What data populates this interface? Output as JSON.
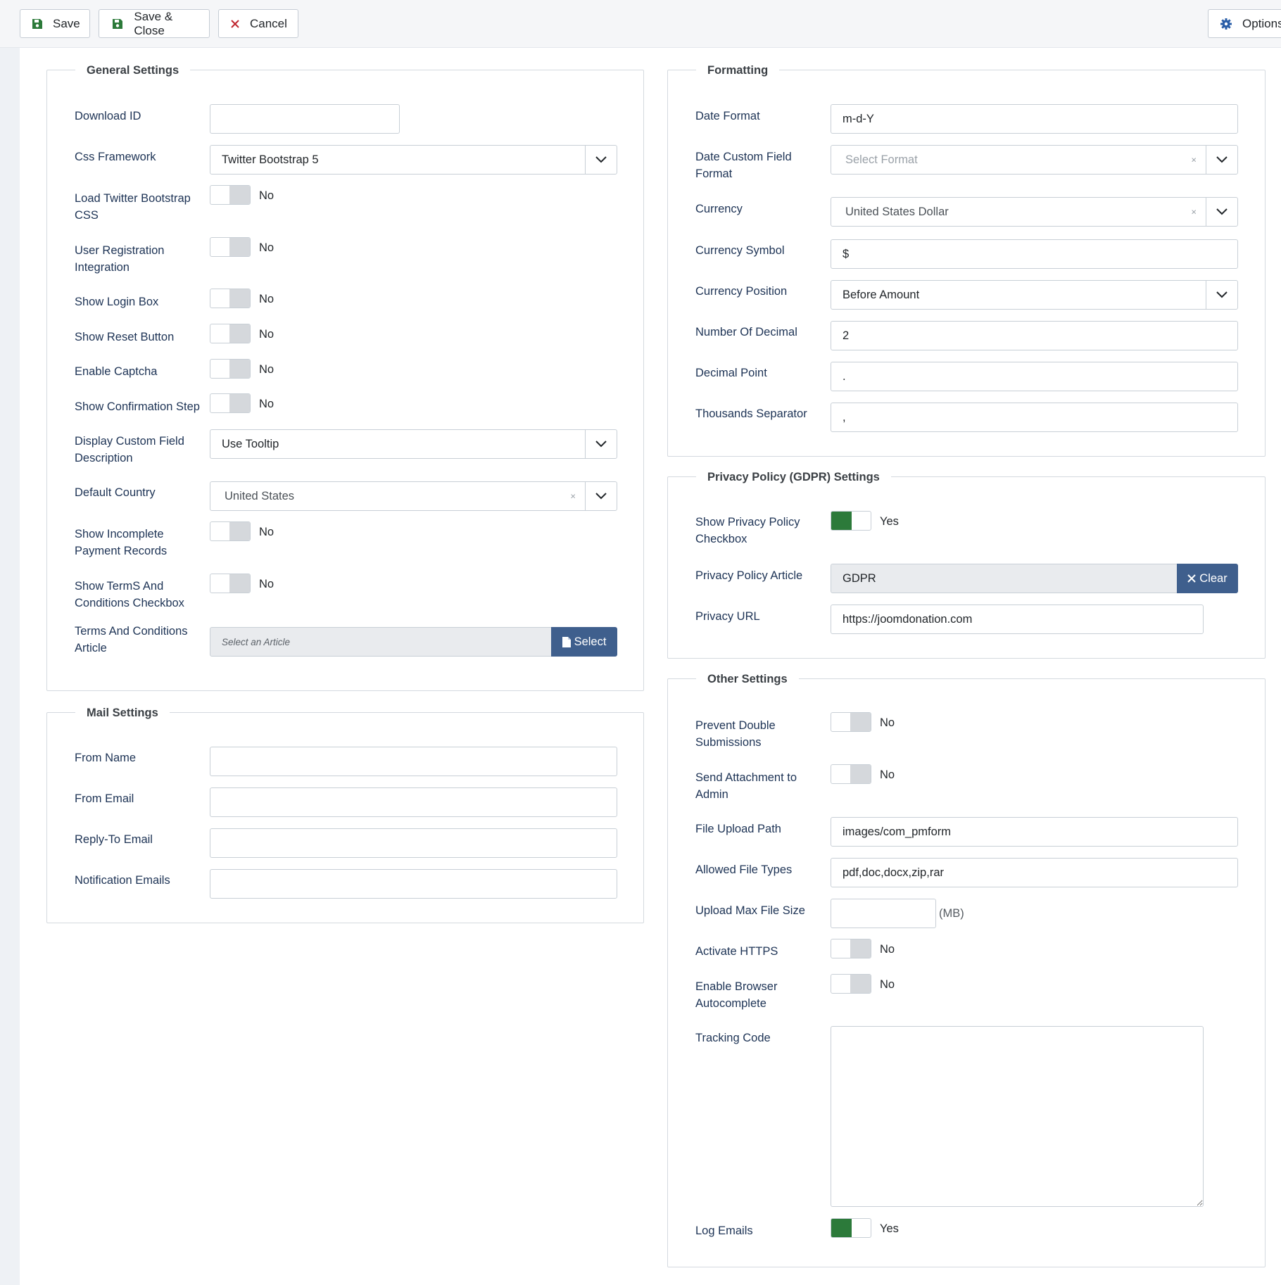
{
  "toolbar": {
    "save": "Save",
    "save_close": "Save & Close",
    "cancel": "Cancel",
    "options": "Options"
  },
  "general": {
    "legend": "General Settings",
    "download_id": {
      "label": "Download ID",
      "value": ""
    },
    "css_framework": {
      "label": "Css Framework",
      "value": "Twitter Bootstrap 5"
    },
    "load_bootstrap": {
      "label1": "Load Twitter Bootstrap",
      "label2": "CSS",
      "value": "No"
    },
    "user_registration": {
      "label1": "User Registration",
      "label2": "Integration",
      "value": "No"
    },
    "show_login": {
      "label": "Show Login Box",
      "value": "No"
    },
    "show_reset": {
      "label": "Show Reset Button",
      "value": "No"
    },
    "enable_captcha": {
      "label": "Enable Captcha",
      "value": "No"
    },
    "show_confirmation": {
      "label": "Show Confirmation Step",
      "value": "No"
    },
    "display_cf_desc": {
      "label1": "Display Custom Field",
      "label2": "Description",
      "value": "Use Tooltip"
    },
    "default_country": {
      "label": "Default Country",
      "value": "United States"
    },
    "show_incomplete": {
      "label1": "Show Incomplete",
      "label2": "Payment Records",
      "value": "No"
    },
    "show_terms": {
      "label1": "Show TermS And",
      "label2": "Conditions Checkbox",
      "value": "No"
    },
    "terms_article": {
      "label1": "Terms And Conditions",
      "label2": "Article",
      "placeholder": "Select an Article",
      "button": "Select"
    }
  },
  "mail": {
    "legend": "Mail Settings",
    "from_name": {
      "label": "From Name",
      "value": ""
    },
    "from_email": {
      "label": "From Email",
      "value": ""
    },
    "reply_to": {
      "label": "Reply-To Email",
      "value": ""
    },
    "notification": {
      "label": "Notification Emails",
      "value": ""
    }
  },
  "formatting": {
    "legend": "Formatting",
    "date_format": {
      "label": "Date Format",
      "value": "m-d-Y"
    },
    "date_cf_format": {
      "label1": "Date Custom Field",
      "label2": "Format",
      "placeholder": "Select Format"
    },
    "currency": {
      "label": "Currency",
      "value": "United States Dollar"
    },
    "currency_symbol": {
      "label": "Currency Symbol",
      "value": "$"
    },
    "currency_position": {
      "label": "Currency Position",
      "value": "Before Amount"
    },
    "num_decimal": {
      "label": "Number Of Decimal",
      "value": "2"
    },
    "decimal_point": {
      "label": "Decimal Point",
      "value": "."
    },
    "thousands_sep": {
      "label": "Thousands Separator",
      "value": ","
    }
  },
  "privacy": {
    "legend": "Privacy Policy (GDPR) Settings",
    "show_checkbox": {
      "label1": "Show Privacy Policy",
      "label2": "Checkbox",
      "value": "Yes"
    },
    "article": {
      "label": "Privacy Policy Article",
      "value": "GDPR",
      "button": "Clear"
    },
    "url": {
      "label": "Privacy URL",
      "value": "https://joomdonation.com"
    }
  },
  "other": {
    "legend": "Other Settings",
    "prevent_double": {
      "label1": "Prevent Double",
      "label2": "Submissions",
      "value": "No"
    },
    "send_attachment": {
      "label1": "Send Attachment to",
      "label2": "Admin",
      "value": "No"
    },
    "upload_path": {
      "label": "File Upload Path",
      "value": "images/com_pmform"
    },
    "allowed_types": {
      "label": "Allowed File Types",
      "value": "pdf,doc,docx,zip,rar"
    },
    "max_size": {
      "label": "Upload Max File Size",
      "value": "",
      "suffix": "(MB)"
    },
    "activate_https": {
      "label": "Activate HTTPS",
      "value": "No"
    },
    "browser_autocomplete": {
      "label1": "Enable Browser",
      "label2": "Autocomplete",
      "value": "No"
    },
    "tracking_code": {
      "label": "Tracking Code",
      "value": ""
    },
    "log_emails": {
      "label": "Log Emails",
      "value": "Yes"
    }
  },
  "colors": {
    "accent": "#3f5f8d",
    "toggle_on": "#2c7a3a",
    "label": "#1d3355"
  }
}
